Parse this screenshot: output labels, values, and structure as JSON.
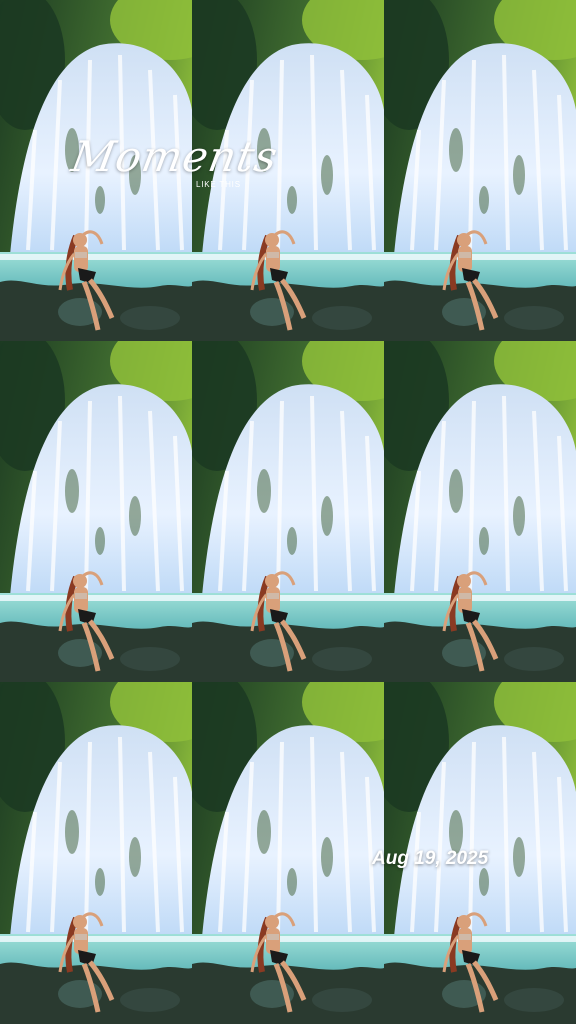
{
  "overlay": {
    "title_script": "Moments",
    "subtitle": "LIKE THIS",
    "date": "Aug 19, 2025"
  },
  "photo": {
    "tiles": [
      {
        "name": "photo-tile-1"
      },
      {
        "name": "photo-tile-2"
      },
      {
        "name": "photo-tile-3"
      },
      {
        "name": "photo-tile-4"
      },
      {
        "name": "photo-tile-5"
      },
      {
        "name": "photo-tile-6"
      },
      {
        "name": "photo-tile-7"
      },
      {
        "name": "photo-tile-8"
      },
      {
        "name": "photo-tile-9"
      }
    ],
    "colors": {
      "foliage_light": "#8fbf3a",
      "foliage_dark": "#1c3a22",
      "water": "#e8f2ff",
      "pool": "#5fb6b8",
      "rocks": "#2a3a30",
      "skin": "#d9a07a",
      "hair": "#8a3a22",
      "swimsuit": "#1a1a1a"
    }
  }
}
